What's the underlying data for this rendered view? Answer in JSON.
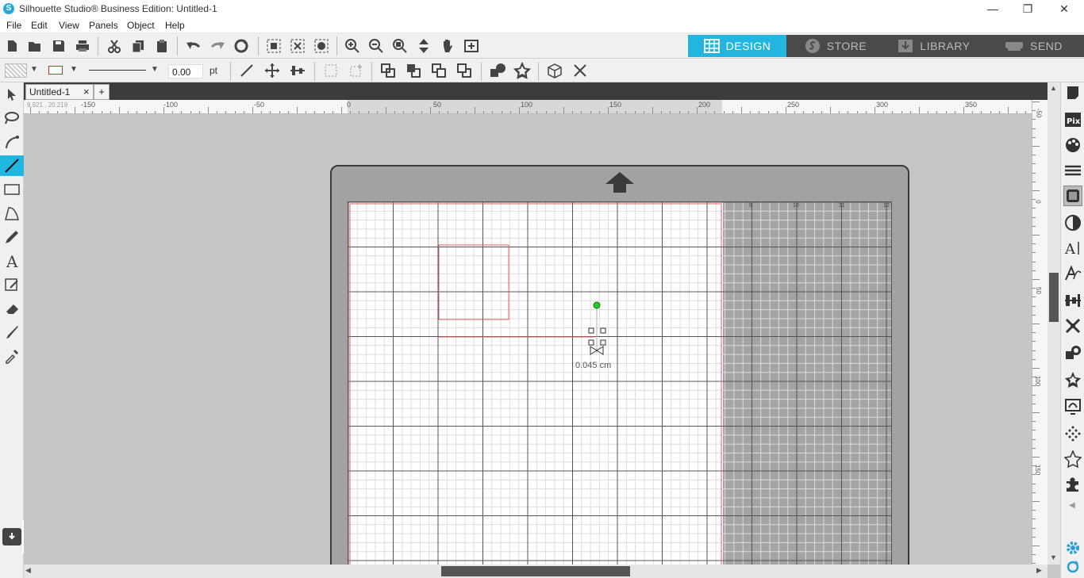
{
  "window": {
    "title": "Silhouette Studio® Business Edition: Untitled-1",
    "logo_letter": "S",
    "minimize": "—",
    "restore": "❐",
    "close": "✕"
  },
  "menu": {
    "items": [
      "File",
      "Edit",
      "View",
      "Panels",
      "Object",
      "Help"
    ]
  },
  "nav_tabs": [
    {
      "label": "DESIGN",
      "active": true
    },
    {
      "label": "STORE",
      "active": false
    },
    {
      "label": "LIBRARY",
      "active": false
    },
    {
      "label": "SEND",
      "active": false
    }
  ],
  "line_props": {
    "width_value": "0.00",
    "unit": "pt"
  },
  "document": {
    "tab_name": "Untitled-1",
    "tab_close": "×",
    "add_tab": "+"
  },
  "rulers": {
    "coord_readout": "9.921 , 20.219",
    "h_labels": [
      "-150",
      "-100",
      "-50",
      "0",
      "50",
      "100",
      "150",
      "200",
      "250",
      "300",
      "350"
    ],
    "v_labels": [
      "-50",
      "0",
      "50",
      "100",
      "150"
    ],
    "mat_labels": [
      "9",
      "10",
      "11",
      "12"
    ]
  },
  "canvas": {
    "measure_label": "0.045 cm"
  },
  "colors": {
    "accent": "#22b5e0",
    "nav_bg": "#4a4a4a",
    "cut_line": "#e06060",
    "handle_green": "#22cc22"
  }
}
